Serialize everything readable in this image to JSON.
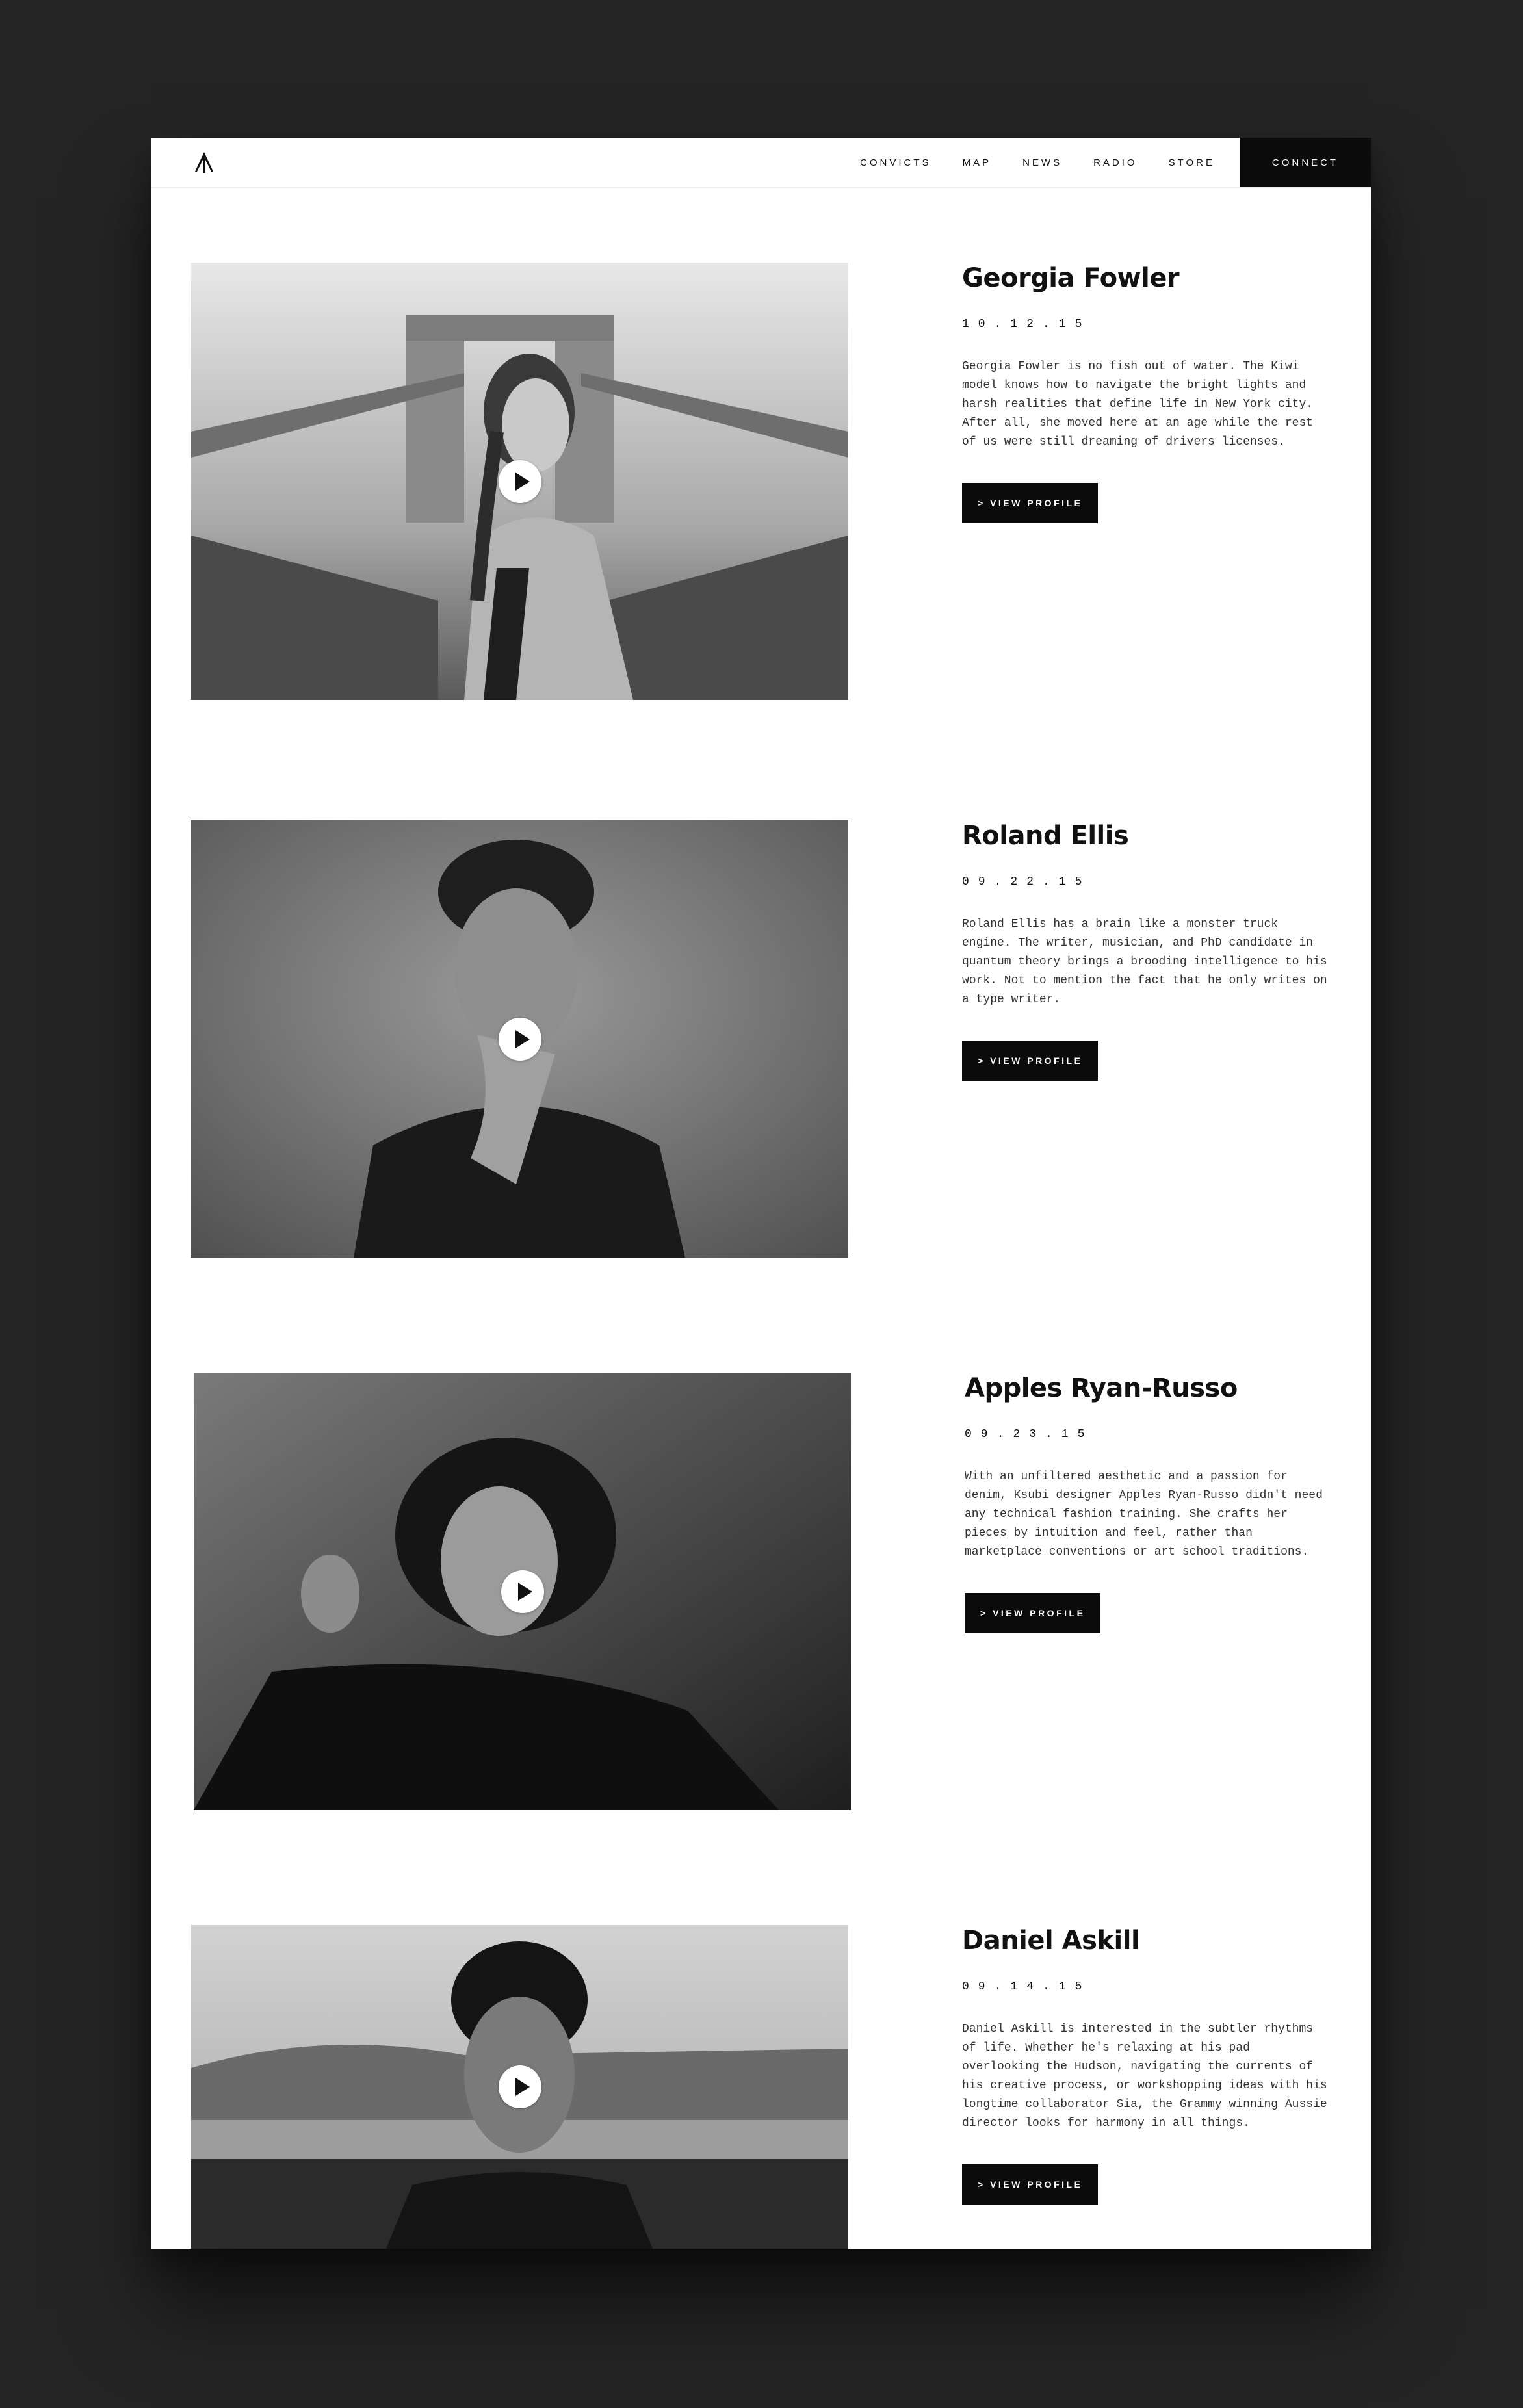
{
  "nav": {
    "links": [
      "CONVICTS",
      "MAP",
      "NEWS",
      "RADIO",
      "STORE"
    ],
    "connect_label": "CONNECT",
    "logo_icon": "arrow-split-logo-icon"
  },
  "profiles": [
    {
      "name": "Georgia Fowler",
      "date": "10.12.15",
      "bio": "Georgia Fowler is no fish out of water. The Kiwi model knows how to navigate the bright lights and harsh realities that define life in New York city. After all, she moved here at an age while the rest of us were still dreaming of drivers licenses.",
      "button_label": "> VIEW PROFILE"
    },
    {
      "name": "Roland Ellis",
      "date": "09.22.15",
      "bio": "Roland Ellis has a brain like a monster truck engine. The writer, musician, and PhD candidate in quantum theory brings a brooding intelligence to his work. Not to mention the fact that he only writes on a type writer.",
      "button_label": "> VIEW PROFILE"
    },
    {
      "name": "Apples Ryan-Russo",
      "date": "09.23.15",
      "bio": "With an unfiltered aesthetic and a passion for denim, Ksubi designer Apples Ryan-Russo didn't need any technical fashion training. She crafts her pieces by intuition and feel, rather than marketplace conventions or art school traditions.",
      "button_label": "> VIEW PROFILE"
    },
    {
      "name": "Daniel Askill",
      "date": "09.14.15",
      "bio": "Daniel Askill is interested in the subtler rhythms of life. Whether he's relaxing at his pad overlooking the Hudson, navigating the currents of his creative process, or workshopping ideas with his longtime collaborator Sia, the Grammy winning Aussie director looks for harmony in all things.",
      "button_label": "> VIEW PROFILE"
    }
  ]
}
